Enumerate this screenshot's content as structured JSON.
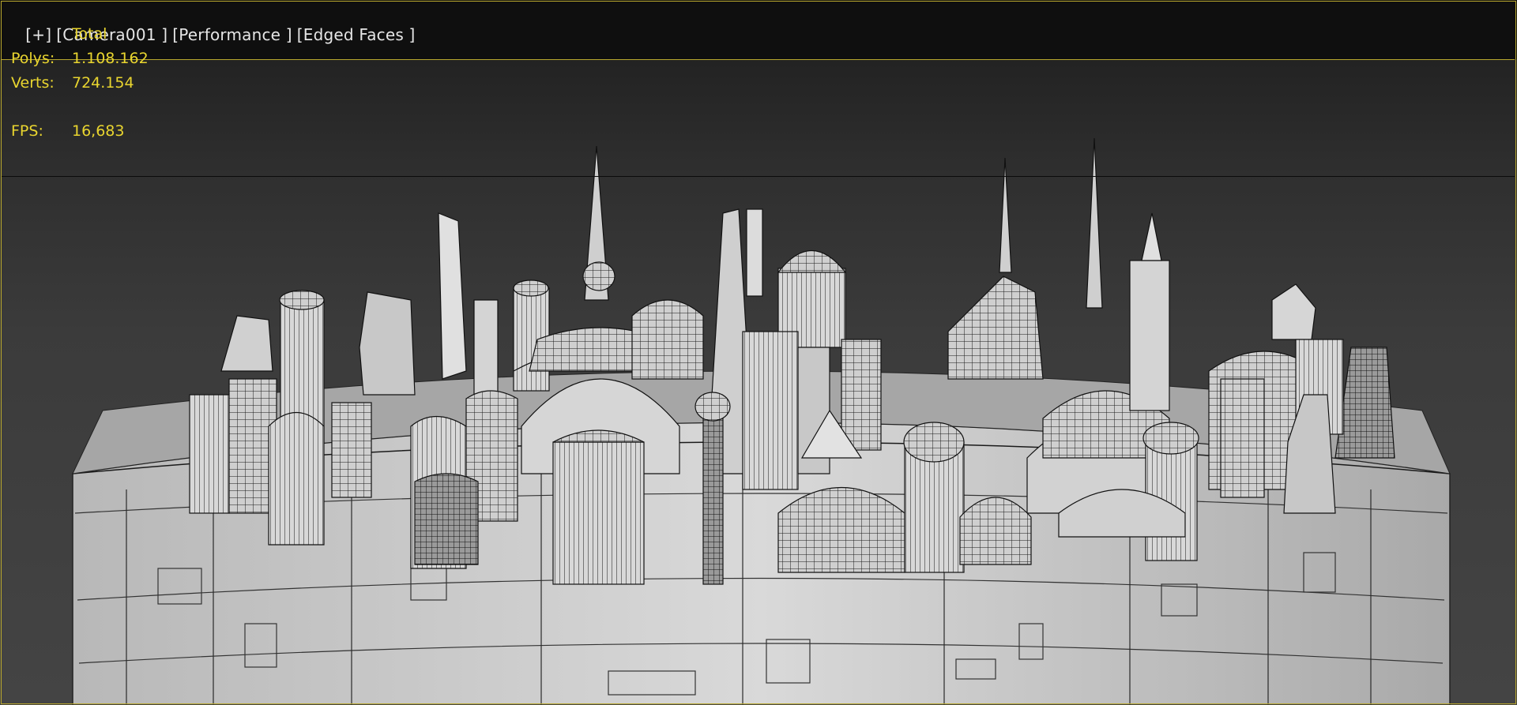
{
  "viewport": {
    "labels": {
      "menu": "[+]",
      "camera": "[Camera001 ]",
      "mode": "[Performance ]",
      "shading": "[Edged Faces ]"
    },
    "stats": {
      "header": "Total",
      "polys_label": "Polys:",
      "polys_value": "1.108.162",
      "verts_label": "Verts:",
      "verts_value": "724.154",
      "fps_label": "FPS:",
      "fps_value": "16,683"
    },
    "colors": {
      "stats_text": "#e9d52f",
      "label_text": "#e6e6e6",
      "border": "#b9a82e",
      "background": "#3b3b3b"
    }
  }
}
